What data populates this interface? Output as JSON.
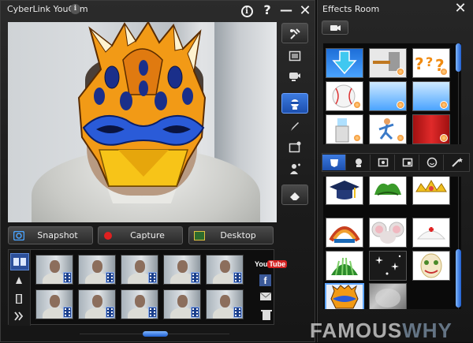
{
  "main_window": {
    "title": "CyberLink YouCam",
    "info_badge": "i",
    "title_info": "i",
    "title_help": "?",
    "title_minimize": "—",
    "title_close": "✕"
  },
  "toolbar_icons": [
    "settings-icon",
    "fullscreen-icon",
    "webcam-icon",
    "avatar-effects-icon",
    "brush-icon",
    "capture-frame-icon",
    "face-tracking-icon",
    "eraser-icon"
  ],
  "actions": {
    "snapshot": "Snapshot",
    "capture": "Capture",
    "desktop": "Desktop"
  },
  "share": {
    "youtube_you": "You",
    "youtube_tube": "Tube",
    "facebook": "f"
  },
  "effects_room": {
    "title": "Effects Room",
    "close": "✕"
  },
  "watermark": {
    "part1": "FAMOUS",
    "part2": "WHY"
  },
  "colors": {
    "accent": "#2a62c9",
    "capture_dot": "#e02020",
    "mask_orange": "#f29a16",
    "mask_blue": "#1a2f8a"
  }
}
